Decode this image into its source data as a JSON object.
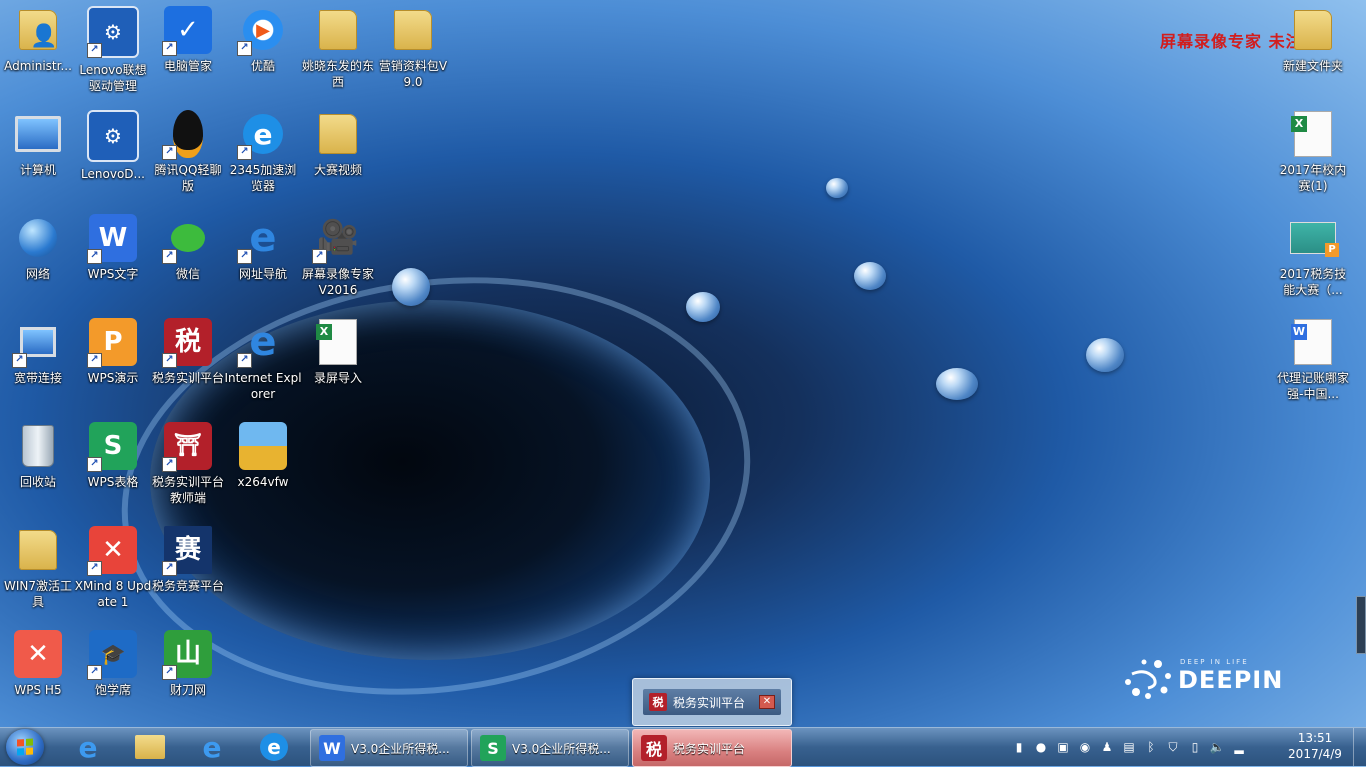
{
  "watermark": "屏幕录像专家  未注册",
  "brand": {
    "tagline": "DEEP IN LIFE",
    "name": "DEEPIN"
  },
  "desktop": {
    "col1": [
      {
        "label": "Administr...",
        "icon": "user-folder-icon"
      },
      {
        "label": "计算机",
        "icon": "computer-icon"
      },
      {
        "label": "网络",
        "icon": "network-icon"
      },
      {
        "label": "宽带连接",
        "icon": "broadband-icon"
      },
      {
        "label": "回收站",
        "icon": "recycle-bin-icon"
      },
      {
        "label": "WIN7激活工具",
        "icon": "folder-icon"
      },
      {
        "label": "WPS H5",
        "icon": "wps-h5-icon"
      }
    ],
    "col2": [
      {
        "label": "Lenovo联想驱动管理",
        "icon": "lenovo-driver-icon"
      },
      {
        "label": "LenovoD...",
        "icon": "lenovo-driver-icon"
      },
      {
        "label": "WPS文字",
        "icon": "wps-writer-icon"
      },
      {
        "label": "WPS演示",
        "icon": "wps-presentation-icon"
      },
      {
        "label": "WPS表格",
        "icon": "wps-spreadsheet-icon"
      },
      {
        "label": "XMind 8 Update 1",
        "icon": "xmind-icon"
      },
      {
        "label": "饱学席",
        "icon": "baoxuexi-icon"
      }
    ],
    "col3": [
      {
        "label": "电脑管家",
        "icon": "pc-manager-icon"
      },
      {
        "label": "腾讯QQ轻聊版",
        "icon": "qq-icon"
      },
      {
        "label": "微信",
        "icon": "wechat-icon"
      },
      {
        "label": "税务实训平台",
        "icon": "tax-training-icon",
        "glyph": "税"
      },
      {
        "label": "税务实训平台教师端",
        "icon": "tax-teacher-icon"
      },
      {
        "label": "税务竞赛平台",
        "icon": "tax-contest-icon",
        "glyph": "赛"
      },
      {
        "label": "财刀网",
        "icon": "caidao-icon"
      }
    ],
    "col4": [
      {
        "label": "优酷",
        "icon": "youku-icon"
      },
      {
        "label": "2345加速浏览器",
        "icon": "browser-2345-icon"
      },
      {
        "label": "网址导航",
        "icon": "ie-nav-icon"
      },
      {
        "label": "Internet Explorer",
        "icon": "ie-icon"
      },
      {
        "label": "x264vfw",
        "icon": "archive-icon"
      }
    ],
    "col5": [
      {
        "label": "姚晓东发的东西",
        "icon": "folder-icon"
      },
      {
        "label": "大赛视频",
        "icon": "folder-icon"
      },
      {
        "label": "屏幕录像专家V2016",
        "icon": "screen-recorder-icon"
      },
      {
        "label": "录屏导入",
        "icon": "excel-file-icon"
      }
    ],
    "col6": [
      {
        "label": "营销资料包V9.0",
        "icon": "folder-icon"
      }
    ],
    "right": [
      {
        "label": "新建文件夹",
        "icon": "folder-icon"
      },
      {
        "label": "2017年校内赛(1)",
        "icon": "excel-file-icon"
      },
      {
        "label": "2017税务技能大赛（...",
        "icon": "presentation-file-icon"
      },
      {
        "label": "代理记账哪家强-中国...",
        "icon": "word-file-icon"
      }
    ]
  },
  "taskbar": {
    "buttons": [
      {
        "label": "V3.0企业所得税...",
        "icon": "wps-writer-icon",
        "glyph": "W"
      },
      {
        "label": "V3.0企业所得税...",
        "icon": "wps-spreadsheet-icon",
        "glyph": "S"
      },
      {
        "label": "税务实训平台",
        "icon": "tax-training-icon",
        "glyph": "税"
      }
    ],
    "preview": {
      "label": "税务实训平台",
      "glyph": "税"
    },
    "clock": {
      "time": "13:51",
      "date": "2017/4/9"
    }
  }
}
